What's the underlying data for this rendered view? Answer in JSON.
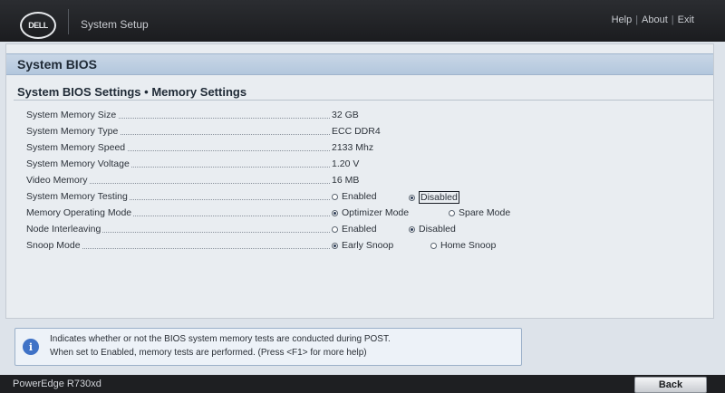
{
  "header": {
    "logo_text": "DELL",
    "app_title": "System Setup",
    "links": {
      "help": "Help",
      "about": "About",
      "exit": "Exit",
      "separator": "|"
    }
  },
  "panel": {
    "title": "System BIOS",
    "section_title": "System BIOS Settings • Memory Settings"
  },
  "settings": {
    "memory_size": {
      "label": "System Memory Size",
      "value": "32 GB"
    },
    "memory_type": {
      "label": "System Memory Type",
      "value": "ECC DDR4"
    },
    "memory_speed": {
      "label": "System Memory Speed",
      "value": "2133 Mhz"
    },
    "memory_voltage": {
      "label": "System Memory Voltage",
      "value": "1.20 V"
    },
    "video_memory": {
      "label": "Video Memory",
      "value": "16 MB"
    },
    "memory_testing": {
      "label": "System Memory Testing",
      "options": [
        "Enabled",
        "Disabled"
      ],
      "selected": "Disabled"
    },
    "operating_mode": {
      "label": "Memory Operating Mode",
      "options": [
        "Optimizer Mode",
        "Spare Mode"
      ],
      "selected": "Optimizer Mode"
    },
    "node_interleaving": {
      "label": "Node Interleaving",
      "options": [
        "Enabled",
        "Disabled"
      ],
      "selected": "Disabled"
    },
    "snoop_mode": {
      "label": "Snoop Mode",
      "options": [
        "Early Snoop",
        "Home Snoop"
      ],
      "selected": "Early Snoop"
    }
  },
  "help_box": {
    "icon": "info-icon",
    "line1": "Indicates whether or not the BIOS system memory tests are conducted during POST.",
    "line2": "When set to Enabled, memory tests are performed. (Press <F1> for more help)"
  },
  "footer": {
    "model": "PowerEdge R730xd",
    "back_label": "Back"
  },
  "colors": {
    "accent_blue": "#3f72c6",
    "header_bg": "#1b1c1f",
    "panel_head_bg": "#b3c7dd"
  }
}
